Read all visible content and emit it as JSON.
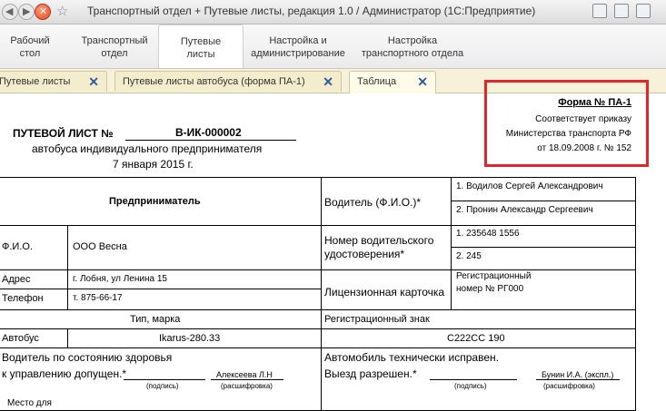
{
  "window": {
    "title": "Транспортный отдел + Путевые листы, редакция 1.0 / Администратор  (1С:Предприятие)"
  },
  "sections": [
    {
      "label": "Рабочий\nстол"
    },
    {
      "label": "Транспортный\nотдел"
    },
    {
      "label": "Путевые\nлисты"
    },
    {
      "label": "Настройка и\nадминистрирование"
    },
    {
      "label": "Настройка\nтранспортного отдела"
    }
  ],
  "tabs": [
    {
      "label": "Путевые листы"
    },
    {
      "label": "Путевые листы автобуса (форма ПА-1)"
    },
    {
      "label": "Таблица"
    }
  ],
  "stamp": {
    "form": "Форма № ПА-1",
    "line1": "Соответствует приказу",
    "line2": "Министерства транспорта РФ",
    "line3": "от 18.09.2008 г. № 152"
  },
  "doc": {
    "title": "ПУТЕВОЙ ЛИСТ №",
    "number": "В-ИК-000002",
    "subtitle": "автобуса индивидуального предпринимателя",
    "date": "7 января 2015 г."
  },
  "table": {
    "entrepreneur": "Предприниматель",
    "fio_label": "Ф.И.О.",
    "fio_value": "ООО Весна",
    "address_label": "Адрес",
    "address_value": "г. Лобня, ул Ленина 15",
    "phone_label": "Телефон",
    "phone_value": "т. 875-66-17",
    "driver_label": "Водитель (Ф.И.О.)*",
    "driver1": "1. Водилов Сергей Александрович",
    "driver2": "2. Пронин Александр Сергеевич",
    "license_label": "Номер водительского удостоверения*",
    "license1": "1. 235648 1556",
    "license2": "2. 245",
    "card_label": "Лицензионная карточка",
    "card_value": "Регистрационный номер № РГ000",
    "type_label": "Тип, марка",
    "reg_label": "Регистрационный знак",
    "bus_label": "Автобус",
    "bus_model": "Ikarus-280.33",
    "reg_value": "С222СС 190",
    "health_1": "Водитель по состоянию здоровья",
    "health_2": "к управлению допущен.*",
    "doctor": "Алексеева Л.Н",
    "sign_caption": "(подпись)",
    "decode_caption": "(расшифровка)",
    "tech_1": "Автомобиль технически исправен.",
    "tech_2": "Выезд разрешен.*",
    "mechanic": "Бунин И.А. (экспл.)",
    "place_label": "Место для"
  }
}
